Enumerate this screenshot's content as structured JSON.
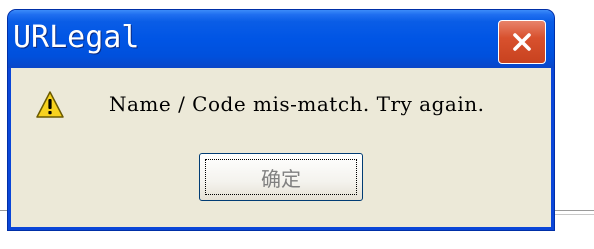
{
  "window": {
    "title": "URLegal",
    "close_icon": "close-icon"
  },
  "dialog": {
    "icon": "warning-icon",
    "message": "Name / Code mis-match. Try again.",
    "ok_label": "确定"
  },
  "colors": {
    "titlebar": "#0055e5",
    "close_button": "#d8512e",
    "dialog_bg": "#ece9d8",
    "warning_yellow": "#f7d21e"
  }
}
